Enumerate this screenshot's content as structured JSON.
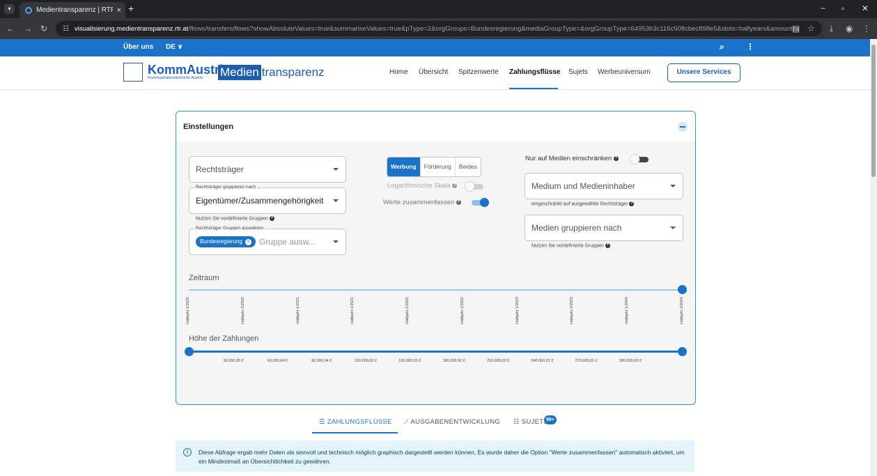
{
  "browser": {
    "tab_title": "Medientransparenz | RTR",
    "tab_close": "×",
    "new_tab": "+",
    "url_host": "visualisierung.medientransparenz.rtr.at",
    "url_path": "/flows/transfers/flows?showAbsoluteValues=true&summariseValues=true&pType=2&orgGroups=Bundesregierung&mediaGroupType=&orgGroupType=64953b3c116c508cbec898e5&slots=halfyears&amountFilter..."
  },
  "topnav": {
    "about": "Über uns",
    "lang": "DE ∨"
  },
  "header": {
    "logo_main": "KommAustria",
    "logo_sub": "Kommunikationsbehörde Austria",
    "brand_a": "Medien",
    "brand_b": "transparenz",
    "menu": [
      "Home",
      "Übersicht",
      "Spitzenwerte",
      "Zahlungsflüsse",
      "Sujets",
      "Werbeuniversum"
    ],
    "services": "Unsere Services"
  },
  "settings": {
    "title": "Einstellungen",
    "rechtstraeger": "Rechtsträger",
    "group_by_label": "Rechtsträger gruppieren nach ...",
    "group_by_value": "Eigentümer/Zusammengehörigkeit",
    "group_hint": "Nutzen Sie vordefinierte Gruppen",
    "groups_label": "Rechtsträger Gruppen auswählen",
    "chip": "Bundesregierung",
    "groups_placeholder": "Gruppe ausw...",
    "seg": [
      "Werbung",
      "Förderung",
      "Beides"
    ],
    "log_scale": "Logarithmische Skala",
    "summarise": "Werte zusammenfassen",
    "only_media": "Nur auf Medien einschränken",
    "medium": "Medium und Medieninhaber",
    "medium_hint": "eingeschränkt auf ausgewählte Rechtsträger",
    "media_group": "Medien gruppieren nach",
    "media_group_hint": "Nutzen Sie vordefinierte Gruppen",
    "zeitraum": "Zeitraum",
    "periods": [
      "Halbjahr 1/2020",
      "Halbjahr 2/2020",
      "Halbjahr 1/2021",
      "Halbjahr 2/2021",
      "Halbjahr 1/2022",
      "Halbjahr 2/2022",
      "Halbjahr 1/2023",
      "Halbjahr 2/2023",
      "Halbjahr 1/2024",
      "Halbjahr 2/2024"
    ],
    "hoehe": "Höhe der Zahlungen",
    "amounts": [
      "30.000,05 €",
      "60.000,04 €",
      "90.000,04 €",
      "120.000,03 €",
      "150.000,03 €",
      "180.000,02 €",
      "210.000,02 €",
      "240.000,01 €",
      "270.000,01 €",
      "300.000,00 €"
    ]
  },
  "tabs": {
    "flows": "ZAHLUNGSFLÜSSE",
    "spending": "AUSGABENENTWICKLUNG",
    "sujets": "SUJETS",
    "badge": "99+"
  },
  "info": {
    "text": "Diese Abfrage ergab mehr Daten als sinnvoll und technisch möglich graphisch dargestellt werden können. Es wurde daher die Option \"Werte zusammenfassen\" automatisch aktiviert, um ein Mindestmaß an Übersichtlichkeit zu gewähren."
  }
}
